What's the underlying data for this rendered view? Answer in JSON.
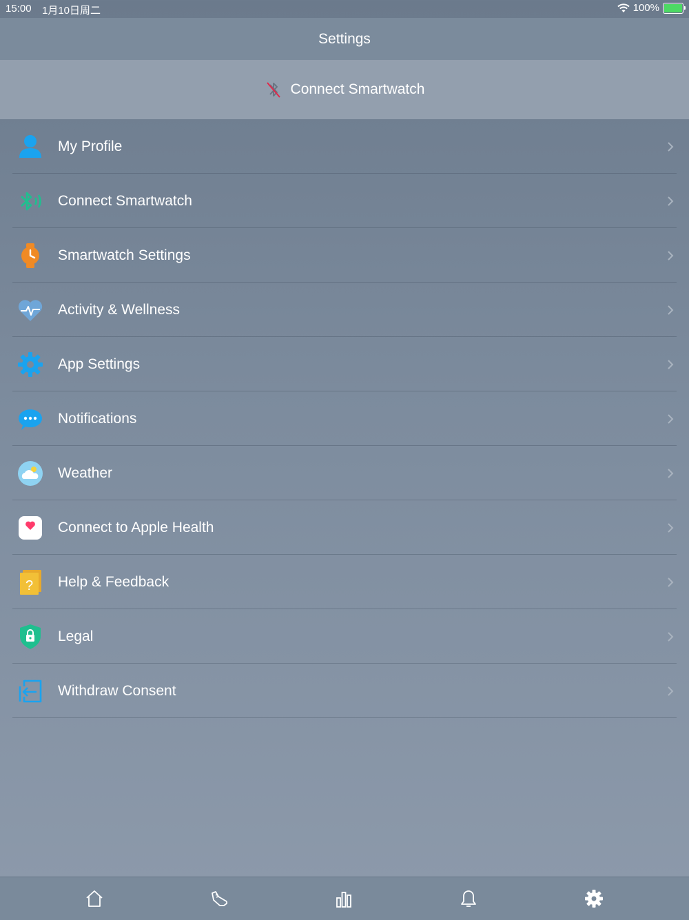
{
  "status_bar": {
    "time": "15:00",
    "date": "1月10日周二",
    "battery": "100%"
  },
  "nav": {
    "title": "Settings"
  },
  "banner": {
    "label": "Connect Smartwatch",
    "icon": "bluetooth-disabled-icon"
  },
  "menu": {
    "items": [
      {
        "label": "My Profile",
        "icon": "profile-icon"
      },
      {
        "label": "Connect Smartwatch",
        "icon": "bluetooth-icon"
      },
      {
        "label": "Smartwatch Settings",
        "icon": "watch-icon"
      },
      {
        "label": "Activity & Wellness",
        "icon": "heart-pulse-icon"
      },
      {
        "label": "App Settings",
        "icon": "gear-icon"
      },
      {
        "label": "Notifications",
        "icon": "chat-bubble-icon"
      },
      {
        "label": "Weather",
        "icon": "weather-icon"
      },
      {
        "label": "Connect to Apple Health",
        "icon": "apple-health-icon"
      },
      {
        "label": "Help & Feedback",
        "icon": "help-icon"
      },
      {
        "label": "Legal",
        "icon": "lock-shield-icon"
      },
      {
        "label": "Withdraw Consent",
        "icon": "withdraw-icon"
      }
    ]
  },
  "tab_bar": {
    "tabs": [
      "home-icon",
      "shoe-icon",
      "stats-icon",
      "bell-icon",
      "settings-gear-icon"
    ],
    "active": "settings-gear-icon"
  },
  "colors": {
    "accent_blue": "#1aa3ef",
    "accent_green": "#1fbf8f",
    "accent_orange": "#f08a24",
    "accent_yellow": "#f2c037",
    "battery_green": "#4cd964"
  }
}
